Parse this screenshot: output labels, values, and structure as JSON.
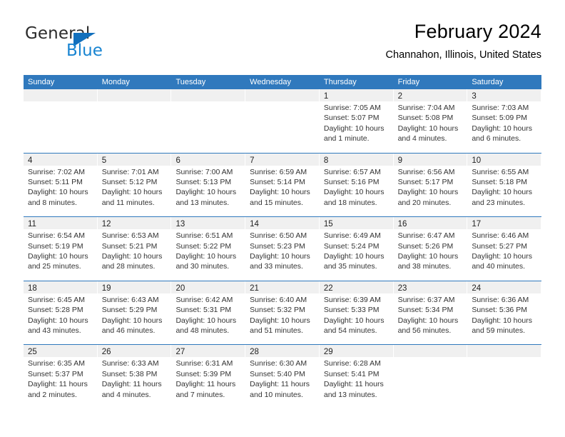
{
  "brand": {
    "name_part1": "General",
    "name_part2": "Blue",
    "triangle_color": "#1270bd",
    "blue_color": "#1884d1"
  },
  "header": {
    "title": "February 2024",
    "subtitle": "Channahon, Illinois, United States"
  },
  "theme": {
    "header_blue": "#3079bd",
    "daynum_band": "#f0f0f0",
    "text": "#333333"
  },
  "calendar": {
    "weekdays": [
      "Sunday",
      "Monday",
      "Tuesday",
      "Wednesday",
      "Thursday",
      "Friday",
      "Saturday"
    ],
    "weeks": [
      [
        {
          "day": "",
          "lines": []
        },
        {
          "day": "",
          "lines": []
        },
        {
          "day": "",
          "lines": []
        },
        {
          "day": "",
          "lines": []
        },
        {
          "day": "1",
          "lines": [
            "Sunrise: 7:05 AM",
            "Sunset: 5:07 PM",
            "Daylight: 10 hours",
            "and 1 minute."
          ]
        },
        {
          "day": "2",
          "lines": [
            "Sunrise: 7:04 AM",
            "Sunset: 5:08 PM",
            "Daylight: 10 hours",
            "and 4 minutes."
          ]
        },
        {
          "day": "3",
          "lines": [
            "Sunrise: 7:03 AM",
            "Sunset: 5:09 PM",
            "Daylight: 10 hours",
            "and 6 minutes."
          ]
        }
      ],
      [
        {
          "day": "4",
          "lines": [
            "Sunrise: 7:02 AM",
            "Sunset: 5:11 PM",
            "Daylight: 10 hours",
            "and 8 minutes."
          ]
        },
        {
          "day": "5",
          "lines": [
            "Sunrise: 7:01 AM",
            "Sunset: 5:12 PM",
            "Daylight: 10 hours",
            "and 11 minutes."
          ]
        },
        {
          "day": "6",
          "lines": [
            "Sunrise: 7:00 AM",
            "Sunset: 5:13 PM",
            "Daylight: 10 hours",
            "and 13 minutes."
          ]
        },
        {
          "day": "7",
          "lines": [
            "Sunrise: 6:59 AM",
            "Sunset: 5:14 PM",
            "Daylight: 10 hours",
            "and 15 minutes."
          ]
        },
        {
          "day": "8",
          "lines": [
            "Sunrise: 6:57 AM",
            "Sunset: 5:16 PM",
            "Daylight: 10 hours",
            "and 18 minutes."
          ]
        },
        {
          "day": "9",
          "lines": [
            "Sunrise: 6:56 AM",
            "Sunset: 5:17 PM",
            "Daylight: 10 hours",
            "and 20 minutes."
          ]
        },
        {
          "day": "10",
          "lines": [
            "Sunrise: 6:55 AM",
            "Sunset: 5:18 PM",
            "Daylight: 10 hours",
            "and 23 minutes."
          ]
        }
      ],
      [
        {
          "day": "11",
          "lines": [
            "Sunrise: 6:54 AM",
            "Sunset: 5:19 PM",
            "Daylight: 10 hours",
            "and 25 minutes."
          ]
        },
        {
          "day": "12",
          "lines": [
            "Sunrise: 6:53 AM",
            "Sunset: 5:21 PM",
            "Daylight: 10 hours",
            "and 28 minutes."
          ]
        },
        {
          "day": "13",
          "lines": [
            "Sunrise: 6:51 AM",
            "Sunset: 5:22 PM",
            "Daylight: 10 hours",
            "and 30 minutes."
          ]
        },
        {
          "day": "14",
          "lines": [
            "Sunrise: 6:50 AM",
            "Sunset: 5:23 PM",
            "Daylight: 10 hours",
            "and 33 minutes."
          ]
        },
        {
          "day": "15",
          "lines": [
            "Sunrise: 6:49 AM",
            "Sunset: 5:24 PM",
            "Daylight: 10 hours",
            "and 35 minutes."
          ]
        },
        {
          "day": "16",
          "lines": [
            "Sunrise: 6:47 AM",
            "Sunset: 5:26 PM",
            "Daylight: 10 hours",
            "and 38 minutes."
          ]
        },
        {
          "day": "17",
          "lines": [
            "Sunrise: 6:46 AM",
            "Sunset: 5:27 PM",
            "Daylight: 10 hours",
            "and 40 minutes."
          ]
        }
      ],
      [
        {
          "day": "18",
          "lines": [
            "Sunrise: 6:45 AM",
            "Sunset: 5:28 PM",
            "Daylight: 10 hours",
            "and 43 minutes."
          ]
        },
        {
          "day": "19",
          "lines": [
            "Sunrise: 6:43 AM",
            "Sunset: 5:29 PM",
            "Daylight: 10 hours",
            "and 46 minutes."
          ]
        },
        {
          "day": "20",
          "lines": [
            "Sunrise: 6:42 AM",
            "Sunset: 5:31 PM",
            "Daylight: 10 hours",
            "and 48 minutes."
          ]
        },
        {
          "day": "21",
          "lines": [
            "Sunrise: 6:40 AM",
            "Sunset: 5:32 PM",
            "Daylight: 10 hours",
            "and 51 minutes."
          ]
        },
        {
          "day": "22",
          "lines": [
            "Sunrise: 6:39 AM",
            "Sunset: 5:33 PM",
            "Daylight: 10 hours",
            "and 54 minutes."
          ]
        },
        {
          "day": "23",
          "lines": [
            "Sunrise: 6:37 AM",
            "Sunset: 5:34 PM",
            "Daylight: 10 hours",
            "and 56 minutes."
          ]
        },
        {
          "day": "24",
          "lines": [
            "Sunrise: 6:36 AM",
            "Sunset: 5:36 PM",
            "Daylight: 10 hours",
            "and 59 minutes."
          ]
        }
      ],
      [
        {
          "day": "25",
          "lines": [
            "Sunrise: 6:35 AM",
            "Sunset: 5:37 PM",
            "Daylight: 11 hours",
            "and 2 minutes."
          ]
        },
        {
          "day": "26",
          "lines": [
            "Sunrise: 6:33 AM",
            "Sunset: 5:38 PM",
            "Daylight: 11 hours",
            "and 4 minutes."
          ]
        },
        {
          "day": "27",
          "lines": [
            "Sunrise: 6:31 AM",
            "Sunset: 5:39 PM",
            "Daylight: 11 hours",
            "and 7 minutes."
          ]
        },
        {
          "day": "28",
          "lines": [
            "Sunrise: 6:30 AM",
            "Sunset: 5:40 PM",
            "Daylight: 11 hours",
            "and 10 minutes."
          ]
        },
        {
          "day": "29",
          "lines": [
            "Sunrise: 6:28 AM",
            "Sunset: 5:41 PM",
            "Daylight: 11 hours",
            "and 13 minutes."
          ]
        },
        {
          "day": "",
          "lines": []
        },
        {
          "day": "",
          "lines": []
        }
      ]
    ]
  }
}
